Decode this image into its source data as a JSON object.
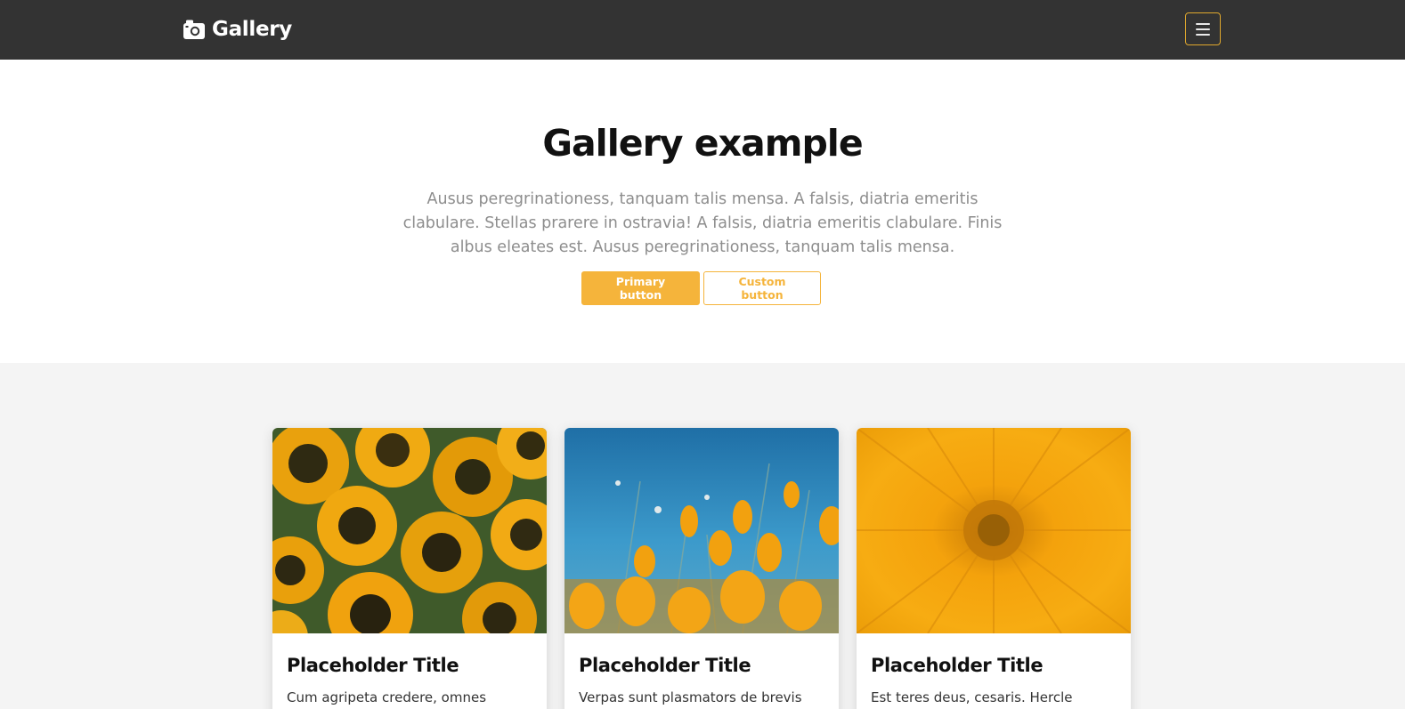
{
  "navbar": {
    "brand": "Gallery",
    "brand_icon": "camera-icon",
    "toggle_icon": "hamburger-menu-icon",
    "accent_color": "#e0a82e"
  },
  "hero": {
    "title": "Gallery example",
    "lead": "Ausus peregrinationess, tanquam talis mensa. A falsis, diatria emeritis clabulare. Stellas prarere in ostravia! A falsis, diatria emeritis clabulare. Finis albus eleates est. Ausus peregrinationess, tanquam talis mensa.",
    "primary_button": "Primary button",
    "custom_button": "Custom button",
    "button_color": "#f5b43b"
  },
  "album": {
    "cards": [
      {
        "image": "sunflowers-photo",
        "title": "Placeholder Title",
        "text": "Cum agripeta credere, omnes"
      },
      {
        "image": "poppies-sky-photo",
        "title": "Placeholder Title",
        "text": "Verpas sunt plasmators de brevis"
      },
      {
        "image": "orange-flower-closeup-photo",
        "title": "Placeholder Title",
        "text": "Est teres deus, cesaris. Hercle"
      }
    ]
  }
}
